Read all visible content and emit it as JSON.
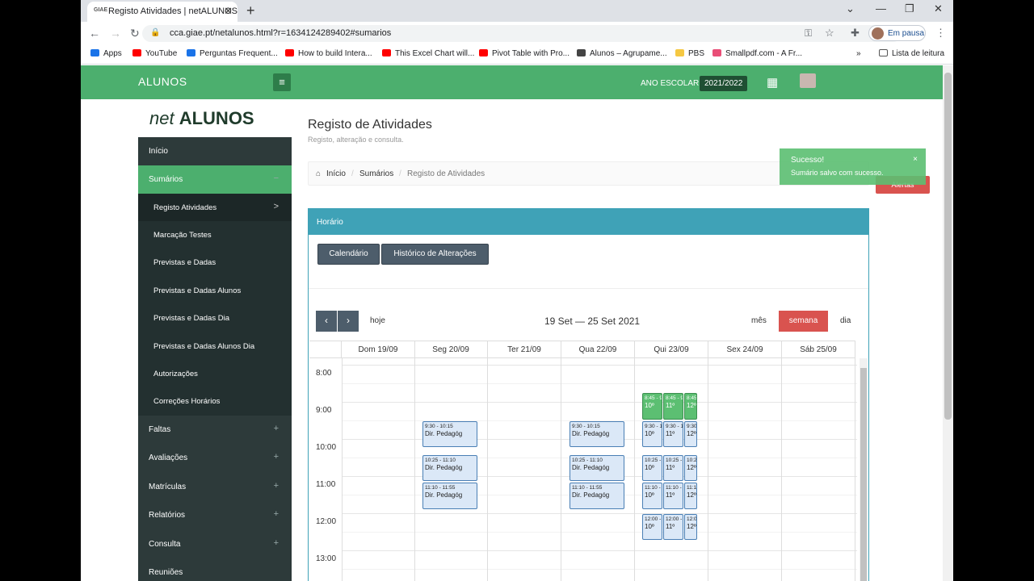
{
  "browser": {
    "tab_title": "Registo Atividades | netALUNOS",
    "tab_favicon": "GIAE",
    "url": "cca.giae.pt/netalunos.html?r=1634124289402#sumarios",
    "profile_label": "Em pausa",
    "bookmarks": [
      {
        "label": "Apps",
        "color": "#1a73e8"
      },
      {
        "label": "YouTube",
        "color": "#ff0000"
      },
      {
        "label": "Perguntas Frequent...",
        "color": "#1a73e8"
      },
      {
        "label": "How to build Intera...",
        "color": "#ff0000"
      },
      {
        "label": "This Excel Chart will...",
        "color": "#ff0000"
      },
      {
        "label": "Pivot Table with Pro...",
        "color": "#ff0000"
      },
      {
        "label": "Alunos – Agrupame...",
        "color": "#444444"
      },
      {
        "label": "PBS",
        "color": "#f5c842"
      },
      {
        "label": "Smallpdf.com - A Fr...",
        "color": "#e94e77"
      }
    ],
    "reading_list": "Lista de leitura"
  },
  "topbar": {
    "brand": "ALUNOS",
    "ano_label": "ANO ESCOLAR",
    "ano_value": "2021/2022"
  },
  "logo": {
    "part1": "net",
    "part2": "ALUNOS"
  },
  "sidebar": {
    "items": [
      {
        "label": "Início",
        "type": "top"
      },
      {
        "label": "Sumários",
        "type": "active",
        "marker": "−"
      },
      {
        "label": "Registo Atividades",
        "type": "cur",
        "marker": ">"
      },
      {
        "label": "Marcação Testes",
        "type": "sub"
      },
      {
        "label": "Previstas e Dadas",
        "type": "sub"
      },
      {
        "label": "Previstas e Dadas Alunos",
        "type": "sub"
      },
      {
        "label": "Previstas e Dadas Dia",
        "type": "sub"
      },
      {
        "label": "Previstas e Dadas Alunos Dia",
        "type": "sub"
      },
      {
        "label": "Autorizações",
        "type": "sub"
      },
      {
        "label": "Correções Horários",
        "type": "sub"
      },
      {
        "label": "Faltas",
        "type": "top",
        "marker": "+"
      },
      {
        "label": "Avaliações",
        "type": "top",
        "marker": "+"
      },
      {
        "label": "Matrículas",
        "type": "top",
        "marker": "+"
      },
      {
        "label": "Relatórios",
        "type": "top",
        "marker": "+"
      },
      {
        "label": "Consulta",
        "type": "top",
        "marker": "+"
      },
      {
        "label": "Reuniões",
        "type": "top"
      }
    ]
  },
  "page": {
    "title": "Registo de Atividades",
    "subtitle": "Registo, alteração e consulta.",
    "breadcrumb": [
      "Início",
      "Sumários",
      "Registo de Atividades"
    ]
  },
  "panel": {
    "title": "Horário",
    "btn_calendario": "Calendário",
    "btn_historico": "Histórico de Alterações"
  },
  "calendar": {
    "today": "hoje",
    "range": "19 Set — 25 Set 2021",
    "view_month": "mês",
    "view_week": "semana",
    "view_day": "dia",
    "days": [
      "Dom 19/09",
      "Seg 20/09",
      "Ter 21/09",
      "Qua 22/09",
      "Qui 23/09",
      "Sex 24/09",
      "Sáb 25/09"
    ],
    "hours": [
      "8:00",
      "9:00",
      "10:00",
      "11:00",
      "12:00",
      "13:00"
    ],
    "events": [
      {
        "day": 1,
        "start": "9:30",
        "end": "10:15",
        "time": "9:30 - 10:15",
        "label": "Dir. Pedagóg"
      },
      {
        "day": 1,
        "start": "10:25",
        "end": "11:10",
        "time": "10:25 - 11:10",
        "label": "Dir. Pedagóg"
      },
      {
        "day": 1,
        "start": "11:10",
        "end": "11:55",
        "time": "11:10 - 11:55",
        "label": "Dir. Pedagóg"
      },
      {
        "day": 3,
        "start": "9:30",
        "end": "10:15",
        "time": "9:30 - 10:15",
        "label": "Dir. Pedagóg"
      },
      {
        "day": 3,
        "start": "10:25",
        "end": "11:10",
        "time": "10:25 - 11:10",
        "label": "Dir. Pedagóg"
      },
      {
        "day": 3,
        "start": "11:10",
        "end": "11:55",
        "time": "11:10 - 11:55",
        "label": "Dir. Pedagóg"
      },
      {
        "day": 4,
        "col": 0,
        "start": "8:45",
        "end": "9:30",
        "time": "8:45 - 9",
        "label": "10º",
        "green": true
      },
      {
        "day": 4,
        "col": 1,
        "start": "8:45",
        "end": "9:30",
        "time": "8:45 - 9",
        "label": "11º",
        "green": true
      },
      {
        "day": 4,
        "col": 2,
        "start": "8:45",
        "end": "9:30",
        "time": "8:45",
        "label": "12º",
        "green": true
      },
      {
        "day": 4,
        "col": 0,
        "start": "9:30",
        "end": "10:15",
        "time": "9:30 - 1",
        "label": "10º"
      },
      {
        "day": 4,
        "col": 1,
        "start": "9:30",
        "end": "10:15",
        "time": "9:30 - 1",
        "label": "11º"
      },
      {
        "day": 4,
        "col": 2,
        "start": "9:30",
        "end": "10:15",
        "time": "9:30",
        "label": "12º"
      },
      {
        "day": 4,
        "col": 0,
        "start": "10:25",
        "end": "11:10",
        "time": "10:25 -",
        "label": "10º"
      },
      {
        "day": 4,
        "col": 1,
        "start": "10:25",
        "end": "11:10",
        "time": "10:25 -",
        "label": "11º"
      },
      {
        "day": 4,
        "col": 2,
        "start": "10:25",
        "end": "11:10",
        "time": "10:2",
        "label": "12º"
      },
      {
        "day": 4,
        "col": 0,
        "start": "11:10",
        "end": "11:55",
        "time": "11:10 -",
        "label": "10º"
      },
      {
        "day": 4,
        "col": 1,
        "start": "11:10",
        "end": "11:55",
        "time": "11:10 -",
        "label": "11º"
      },
      {
        "day": 4,
        "col": 2,
        "start": "11:10",
        "end": "11:55",
        "time": "11:1",
        "label": "12º"
      },
      {
        "day": 4,
        "col": 0,
        "start": "12:00",
        "end": "12:45",
        "time": "12:00 -",
        "label": "10º"
      },
      {
        "day": 4,
        "col": 1,
        "start": "12:00",
        "end": "12:45",
        "time": "12:00 -",
        "label": "11º"
      },
      {
        "day": 4,
        "col": 2,
        "start": "12:00",
        "end": "12:45",
        "time": "12:0",
        "label": "12º"
      }
    ]
  },
  "toast": {
    "title": "Sucesso!",
    "message": "Sumário salvo com sucesso."
  },
  "alert_button": "Alertas"
}
